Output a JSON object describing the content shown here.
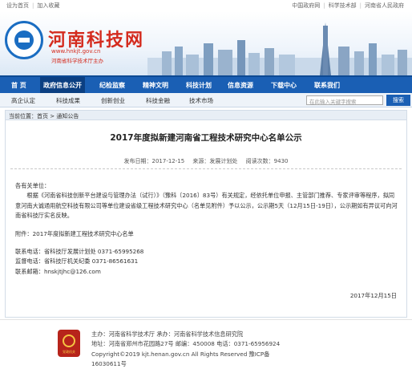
{
  "topbar": {
    "left": [
      "设为首页",
      "加入收藏"
    ],
    "right": [
      "中国政府网",
      "科学技术部",
      "河南省人民政府"
    ]
  },
  "banner": {
    "title": "河南科技网",
    "url": "www.hnkjt.gov.cn",
    "sub": "河南省科学技术厅主办"
  },
  "nav": [
    "首 页",
    "政府信息公开",
    "纪检监察",
    "精神文明",
    "科技计划",
    "信息资源",
    "下载中心",
    "联系我们"
  ],
  "subnav": {
    "items": [
      "高企认定",
      "科技成果",
      "创新创业",
      "科技金融",
      "技术市场"
    ],
    "search_placeholder": "在此输入关键字搜索",
    "search_button": "搜索"
  },
  "breadcrumb": "当前位置：首页 > 通知公告",
  "article": {
    "title": "2017年度拟新建河南省工程技术研究中心名单公示",
    "date_label": "发布日期：2017-12-15",
    "source_label": "来源：发展计划处",
    "views_label": "阅读次数：",
    "views": "9430",
    "greeting": "各有关单位：",
    "paragraph": "根据《河南省科技创新平台建设与管理办法（试行）》（豫科〔2016〕83号）有关规定，经依托单位申报、主管部门推荐、专家评审等程序，拟同意河南大诚通用航空科技有限公司等单位建设省级工程技术研究中心（名单见附件）予以公示，公示期5天（12月15日-19日），公示期如有异议可向河南省科技厅实名反映。",
    "attachment": "附件：2017年度拟新建工程技术研究中心名单",
    "contact1": "联系电话：省科技厅发展计划处  0371-65995268",
    "contact2": "监督电话：省科技厅机关纪委  0371-86561631",
    "contact3": "联系邮箱：hnskjtjhc@126.com",
    "sign_date": "2017年12月15日"
  },
  "footer": {
    "badge_text": "党政机关",
    "line1": "主办：河南省科学技术厅    承办：河南省科学技术信息研究院",
    "line2": "地址：河南省郑州市花园路27号    邮编：450008    电话：0371-65956924",
    "line3": "Copyright©2019 kjt.henan.gov.cn All Rights Reserved 豫ICP备16030611号"
  }
}
